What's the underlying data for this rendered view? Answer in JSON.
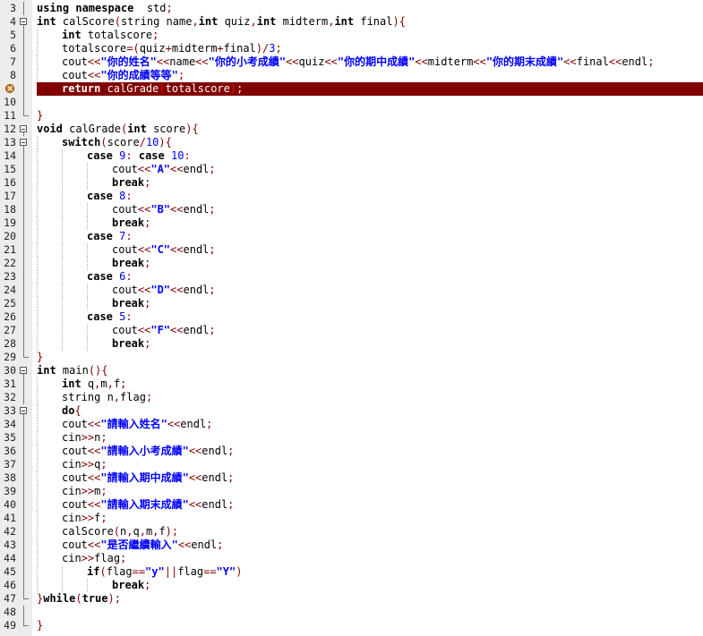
{
  "editor": {
    "language": "C++",
    "breakpoint_line": 8,
    "colors": {
      "gutter": "#ececec",
      "breakpoint_line": "#800000",
      "string": "#0000ff",
      "symbol": "#800000",
      "matched_paren": "#ff0000"
    },
    "lines": [
      {
        "n": "3",
        "fold": "bar",
        "indent": 0,
        "tokens": [
          [
            "kw",
            "using namespace"
          ],
          [
            "",
            "  std"
          ],
          [
            "sym",
            ";"
          ]
        ]
      },
      {
        "n": "4",
        "fold": "box",
        "indent": 0,
        "tokens": [
          [
            "kw",
            "int"
          ],
          [
            "",
            " calScore"
          ],
          [
            "sym",
            "("
          ],
          [
            "",
            "string name"
          ],
          [
            "sym",
            ","
          ],
          [
            "kw",
            "int"
          ],
          [
            "",
            " quiz"
          ],
          [
            "sym",
            ","
          ],
          [
            "kw",
            "int"
          ],
          [
            "",
            " midterm"
          ],
          [
            "sym",
            ","
          ],
          [
            "kw",
            "int"
          ],
          [
            "",
            " final"
          ],
          [
            "sym",
            "){"
          ]
        ]
      },
      {
        "n": "5",
        "fold": "bar",
        "indent": 1,
        "tokens": [
          [
            "kw",
            "int"
          ],
          [
            "",
            " totalscore"
          ],
          [
            "sym",
            ";"
          ]
        ]
      },
      {
        "n": "6",
        "fold": "bar",
        "indent": 1,
        "tokens": [
          [
            "",
            "totalscore"
          ],
          [
            "sym",
            "=("
          ],
          [
            "",
            "quiz"
          ],
          [
            "sym",
            "+"
          ],
          [
            "",
            "midterm"
          ],
          [
            "sym",
            "+"
          ],
          [
            "",
            "final"
          ],
          [
            "sym",
            ")/"
          ],
          [
            "num",
            "3"
          ],
          [
            "sym",
            ";"
          ]
        ]
      },
      {
        "n": "7",
        "fold": "bar",
        "indent": 1,
        "tokens": [
          [
            "",
            "cout"
          ],
          [
            "sym",
            "<<"
          ],
          [
            "str",
            "\"你的姓名\""
          ],
          [
            "sym",
            "<<"
          ],
          [
            "",
            "name"
          ],
          [
            "sym",
            "<<"
          ],
          [
            "str",
            "\"你的小考成績\""
          ],
          [
            "sym",
            "<<"
          ],
          [
            "",
            "quiz"
          ],
          [
            "sym",
            "<<"
          ],
          [
            "str",
            "\"你的期中成績\""
          ],
          [
            "sym",
            "<<"
          ],
          [
            "",
            "midterm"
          ],
          [
            "sym",
            "<<"
          ],
          [
            "str",
            "\"你的期末成績\""
          ],
          [
            "sym",
            "<<"
          ],
          [
            "",
            "final"
          ],
          [
            "sym",
            "<<"
          ],
          [
            "",
            "endl"
          ],
          [
            "sym",
            ";"
          ]
        ]
      },
      {
        "n": "8",
        "fold": "bar",
        "indent": 1,
        "tokens": [
          [
            "",
            "cout"
          ],
          [
            "sym",
            "<<"
          ],
          [
            "str",
            "\"你的成績等等\""
          ],
          [
            "sym",
            ";"
          ]
        ]
      },
      {
        "n": "",
        "bp": true,
        "fold": "bar",
        "indent": 1,
        "tokens": [
          [
            "kw",
            "return"
          ],
          [
            "",
            " calGrade"
          ],
          [
            "brk",
            "("
          ],
          [
            "",
            "totalscore"
          ],
          [
            "brk",
            ")"
          ],
          [
            "sym",
            ";"
          ]
        ]
      },
      {
        "n": "10",
        "fold": "bar",
        "indent": 0,
        "tokens": []
      },
      {
        "n": "11",
        "fold": "end",
        "indent": 0,
        "tokens": [
          [
            "sym",
            "}"
          ]
        ]
      },
      {
        "n": "12",
        "fold": "box",
        "indent": 0,
        "tokens": [
          [
            "kw",
            "void"
          ],
          [
            "",
            " calGrade"
          ],
          [
            "sym",
            "("
          ],
          [
            "kw",
            "int"
          ],
          [
            "",
            " score"
          ],
          [
            "sym",
            "){"
          ]
        ]
      },
      {
        "n": "13",
        "fold": "box",
        "indent": 1,
        "tokens": [
          [
            "kw",
            "switch"
          ],
          [
            "sym",
            "("
          ],
          [
            "",
            "score"
          ],
          [
            "sym",
            "/"
          ],
          [
            "num",
            "10"
          ],
          [
            "sym",
            "){"
          ]
        ]
      },
      {
        "n": "14",
        "fold": "bar",
        "indent": 2,
        "tokens": [
          [
            "kw",
            "case"
          ],
          [
            "",
            " "
          ],
          [
            "num",
            "9"
          ],
          [
            "sym",
            ":"
          ],
          [
            "",
            " "
          ],
          [
            "kw",
            "case"
          ],
          [
            "",
            " "
          ],
          [
            "num",
            "10"
          ],
          [
            "sym",
            ":"
          ]
        ]
      },
      {
        "n": "15",
        "fold": "bar",
        "indent": 3,
        "tokens": [
          [
            "",
            "cout"
          ],
          [
            "sym",
            "<<"
          ],
          [
            "str",
            "\"A\""
          ],
          [
            "sym",
            "<<"
          ],
          [
            "",
            "endl"
          ],
          [
            "sym",
            ";"
          ]
        ]
      },
      {
        "n": "16",
        "fold": "bar",
        "indent": 3,
        "tokens": [
          [
            "kw",
            "break"
          ],
          [
            "sym",
            ";"
          ]
        ]
      },
      {
        "n": "17",
        "fold": "bar",
        "indent": 2,
        "tokens": [
          [
            "kw",
            "case"
          ],
          [
            "",
            " "
          ],
          [
            "num",
            "8"
          ],
          [
            "sym",
            ":"
          ]
        ]
      },
      {
        "n": "18",
        "fold": "bar",
        "indent": 3,
        "tokens": [
          [
            "",
            "cout"
          ],
          [
            "sym",
            "<<"
          ],
          [
            "str",
            "\"B\""
          ],
          [
            "sym",
            "<<"
          ],
          [
            "",
            "endl"
          ],
          [
            "sym",
            ";"
          ]
        ]
      },
      {
        "n": "19",
        "fold": "bar",
        "indent": 3,
        "tokens": [
          [
            "kw",
            "break"
          ],
          [
            "sym",
            ";"
          ]
        ]
      },
      {
        "n": "20",
        "fold": "bar",
        "indent": 2,
        "tokens": [
          [
            "kw",
            "case"
          ],
          [
            "",
            " "
          ],
          [
            "num",
            "7"
          ],
          [
            "sym",
            ":"
          ]
        ]
      },
      {
        "n": "21",
        "fold": "bar",
        "indent": 3,
        "tokens": [
          [
            "",
            "cout"
          ],
          [
            "sym",
            "<<"
          ],
          [
            "str",
            "\"C\""
          ],
          [
            "sym",
            "<<"
          ],
          [
            "",
            "endl"
          ],
          [
            "sym",
            ";"
          ]
        ]
      },
      {
        "n": "22",
        "fold": "bar",
        "indent": 3,
        "tokens": [
          [
            "kw",
            "break"
          ],
          [
            "sym",
            ";"
          ]
        ]
      },
      {
        "n": "23",
        "fold": "bar",
        "indent": 2,
        "tokens": [
          [
            "kw",
            "case"
          ],
          [
            "",
            " "
          ],
          [
            "num",
            "6"
          ],
          [
            "sym",
            ":"
          ]
        ]
      },
      {
        "n": "24",
        "fold": "bar",
        "indent": 3,
        "tokens": [
          [
            "",
            "cout"
          ],
          [
            "sym",
            "<<"
          ],
          [
            "str",
            "\"D\""
          ],
          [
            "sym",
            "<<"
          ],
          [
            "",
            "endl"
          ],
          [
            "sym",
            ";"
          ]
        ]
      },
      {
        "n": "25",
        "fold": "bar",
        "indent": 3,
        "tokens": [
          [
            "kw",
            "break"
          ],
          [
            "sym",
            ";"
          ]
        ]
      },
      {
        "n": "26",
        "fold": "bar",
        "indent": 2,
        "tokens": [
          [
            "kw",
            "case"
          ],
          [
            "",
            " "
          ],
          [
            "num",
            "5"
          ],
          [
            "sym",
            ":"
          ]
        ]
      },
      {
        "n": "27",
        "fold": "bar",
        "indent": 3,
        "tokens": [
          [
            "",
            "cout"
          ],
          [
            "sym",
            "<<"
          ],
          [
            "str",
            "\"F\""
          ],
          [
            "sym",
            "<<"
          ],
          [
            "",
            "endl"
          ],
          [
            "sym",
            ";"
          ]
        ]
      },
      {
        "n": "28",
        "fold": "bar",
        "indent": 3,
        "tokens": [
          [
            "kw",
            "break"
          ],
          [
            "sym",
            ";"
          ]
        ]
      },
      {
        "n": "29",
        "fold": "end",
        "indent": 0,
        "tokens": [
          [
            "sym",
            "}"
          ]
        ]
      },
      {
        "n": "30",
        "fold": "box",
        "indent": 0,
        "tokens": [
          [
            "kw",
            "int"
          ],
          [
            "",
            " main"
          ],
          [
            "sym",
            "(){"
          ]
        ]
      },
      {
        "n": "31",
        "fold": "bar",
        "indent": 1,
        "tokens": [
          [
            "kw",
            "int"
          ],
          [
            "",
            " q"
          ],
          [
            "sym",
            ","
          ],
          [
            "",
            "m"
          ],
          [
            "sym",
            ","
          ],
          [
            "",
            "f"
          ],
          [
            "sym",
            ";"
          ]
        ]
      },
      {
        "n": "32",
        "fold": "bar",
        "indent": 1,
        "tokens": [
          [
            "",
            "string n"
          ],
          [
            "sym",
            ","
          ],
          [
            "",
            "flag"
          ],
          [
            "sym",
            ";"
          ]
        ]
      },
      {
        "n": "33",
        "fold": "box",
        "indent": 1,
        "tokens": [
          [
            "kw",
            "do"
          ],
          [
            "sym",
            "{"
          ]
        ]
      },
      {
        "n": "34",
        "fold": "bar",
        "indent": 1,
        "tokens": [
          [
            "",
            "cout"
          ],
          [
            "sym",
            "<<"
          ],
          [
            "str",
            "\"請輸入姓名\""
          ],
          [
            "sym",
            "<<"
          ],
          [
            "",
            "endl"
          ],
          [
            "sym",
            ";"
          ]
        ]
      },
      {
        "n": "35",
        "fold": "bar",
        "indent": 1,
        "tokens": [
          [
            "",
            "cin"
          ],
          [
            "sym",
            ">>"
          ],
          [
            "",
            "n"
          ],
          [
            "sym",
            ";"
          ]
        ]
      },
      {
        "n": "36",
        "fold": "bar",
        "indent": 1,
        "tokens": [
          [
            "",
            "cout"
          ],
          [
            "sym",
            "<<"
          ],
          [
            "str",
            "\"請輸入小考成績\""
          ],
          [
            "sym",
            "<<"
          ],
          [
            "",
            "endl"
          ],
          [
            "sym",
            ";"
          ]
        ]
      },
      {
        "n": "37",
        "fold": "bar",
        "indent": 1,
        "tokens": [
          [
            "",
            "cin"
          ],
          [
            "sym",
            ">>"
          ],
          [
            "",
            "q"
          ],
          [
            "sym",
            ";"
          ]
        ]
      },
      {
        "n": "38",
        "fold": "bar",
        "indent": 1,
        "tokens": [
          [
            "",
            "cout"
          ],
          [
            "sym",
            "<<"
          ],
          [
            "str",
            "\"請輸入期中成績\""
          ],
          [
            "sym",
            "<<"
          ],
          [
            "",
            "endl"
          ],
          [
            "sym",
            ";"
          ]
        ]
      },
      {
        "n": "39",
        "fold": "bar",
        "indent": 1,
        "tokens": [
          [
            "",
            "cin"
          ],
          [
            "sym",
            ">>"
          ],
          [
            "",
            "m"
          ],
          [
            "sym",
            ";"
          ]
        ]
      },
      {
        "n": "40",
        "fold": "bar",
        "indent": 1,
        "tokens": [
          [
            "",
            "cout"
          ],
          [
            "sym",
            "<<"
          ],
          [
            "str",
            "\"請輸入期末成績\""
          ],
          [
            "sym",
            "<<"
          ],
          [
            "",
            "endl"
          ],
          [
            "sym",
            ";"
          ]
        ]
      },
      {
        "n": "41",
        "fold": "bar",
        "indent": 1,
        "tokens": [
          [
            "",
            "cin"
          ],
          [
            "sym",
            ">>"
          ],
          [
            "",
            "f"
          ],
          [
            "sym",
            ";"
          ]
        ]
      },
      {
        "n": "42",
        "fold": "bar",
        "indent": 1,
        "tokens": [
          [
            "",
            "calScore"
          ],
          [
            "sym",
            "("
          ],
          [
            "",
            "n"
          ],
          [
            "sym",
            ","
          ],
          [
            "",
            "q"
          ],
          [
            "sym",
            ","
          ],
          [
            "",
            "m"
          ],
          [
            "sym",
            ","
          ],
          [
            "",
            "f"
          ],
          [
            "sym",
            ");"
          ]
        ]
      },
      {
        "n": "43",
        "fold": "bar",
        "indent": 1,
        "tokens": [
          [
            "",
            "cout"
          ],
          [
            "sym",
            "<<"
          ],
          [
            "str",
            "\"是否繼續輸入\""
          ],
          [
            "sym",
            "<<"
          ],
          [
            "",
            "endl"
          ],
          [
            "sym",
            ";"
          ]
        ]
      },
      {
        "n": "44",
        "fold": "bar",
        "indent": 1,
        "tokens": [
          [
            "",
            "cin"
          ],
          [
            "sym",
            ">>"
          ],
          [
            "",
            "flag"
          ],
          [
            "sym",
            ";"
          ]
        ]
      },
      {
        "n": "45",
        "fold": "bar",
        "indent": 2,
        "tokens": [
          [
            "kw",
            "if"
          ],
          [
            "sym",
            "("
          ],
          [
            "",
            "flag"
          ],
          [
            "sym",
            "=="
          ],
          [
            "str",
            "\"y\""
          ],
          [
            "sym",
            "||"
          ],
          [
            "",
            "flag"
          ],
          [
            "sym",
            "=="
          ],
          [
            "str",
            "\"Y\""
          ],
          [
            "sym",
            ")"
          ]
        ]
      },
      {
        "n": "46",
        "fold": "bar",
        "indent": 3,
        "tokens": [
          [
            "kw",
            "break"
          ],
          [
            "sym",
            ";"
          ]
        ]
      },
      {
        "n": "47",
        "fold": "end",
        "indent": 0,
        "tokens": [
          [
            "sym",
            "}"
          ],
          [
            "kw",
            "while"
          ],
          [
            "sym",
            "("
          ],
          [
            "kw",
            "true"
          ],
          [
            "sym",
            ");"
          ]
        ]
      },
      {
        "n": "48",
        "fold": "bar",
        "indent": 0,
        "tokens": []
      },
      {
        "n": "49",
        "fold": "end",
        "indent": 0,
        "tokens": [
          [
            "sym",
            "}"
          ]
        ]
      }
    ]
  }
}
